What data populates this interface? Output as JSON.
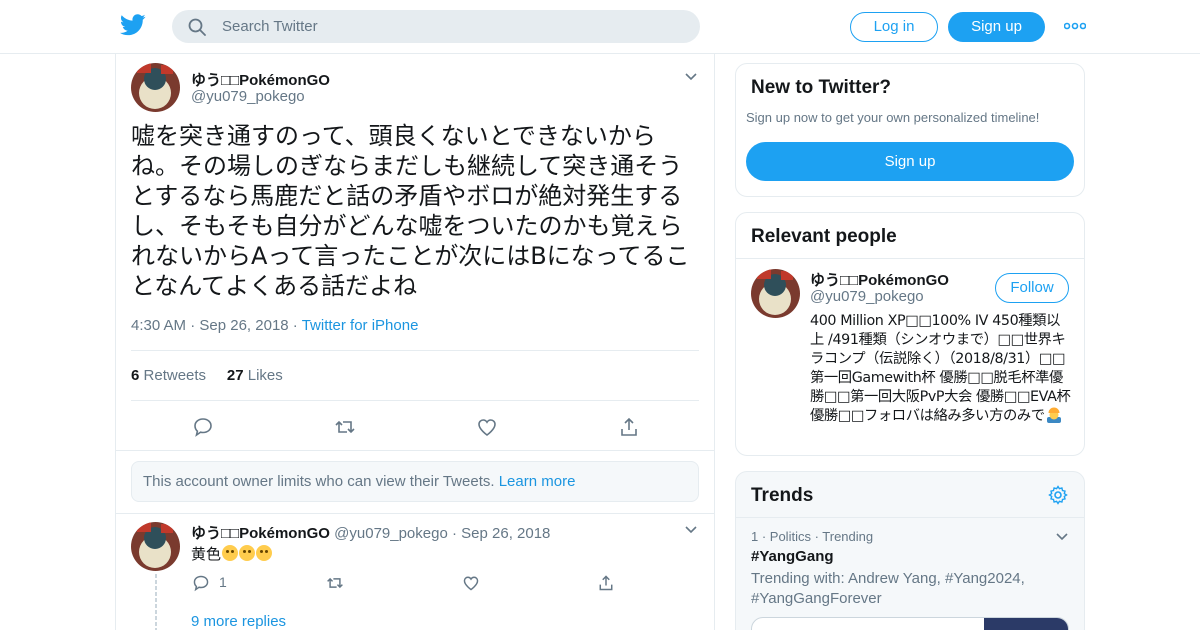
{
  "header": {
    "search_placeholder": "Search Twitter",
    "login_label": "Log in",
    "signup_label": "Sign up"
  },
  "tweet": {
    "author_name": "ゆう□□PokémonGO",
    "author_handle": "@yu079_pokego",
    "text": "嘘を突き通すのって、頭良くないとできないからね。その場しのぎならまだしも継続して突き通そうとするなら馬鹿だと話の矛盾やボロが絶対発生するし、そもそも自分がどんな嘘をついたのかも覚えられないからAって言ったことが次にはBになってることなんてよくある話だよね",
    "time": "4:30 AM",
    "date": "Sep 26, 2018",
    "source": "Twitter for iPhone",
    "retweets_count": "6",
    "retweets_label": "Retweets",
    "likes_count": "27",
    "likes_label": "Likes"
  },
  "notice": {
    "text": "This account owner limits who can view their Tweets.",
    "link": "Learn more"
  },
  "reply": {
    "author_name": "ゆう□□PokémonGO",
    "author_handle": "@yu079_pokego",
    "date": "Sep 26, 2018",
    "text": "黄色",
    "reply_count": "1",
    "more_replies": "9 more replies"
  },
  "sidebar": {
    "new_title": "New to Twitter?",
    "new_sub": "Sign up now to get your own personalized timeline!",
    "new_signup": "Sign up",
    "people_title": "Relevant people",
    "person_name": "ゆう□□PokémonGO",
    "person_handle": "@yu079_pokego",
    "follow_label": "Follow",
    "person_bio": "400 Million XP□□100% IV 450種類以上 /491種類（シンオウまで）□□世界キラコンプ（伝説除く）（2018/8/31）□□第一回Gamewith杯 優勝□□脱毛杯準優勝□□第一回大阪PvP大会 優勝□□EVA杯優勝□□フォロバは絡み多い方のみで",
    "trends_title": "Trends",
    "trend_meta": "1 · Politics · Trending",
    "trend_tag": "#YangGang",
    "trend_with": "Trending with: Andrew Yang, #Yang2024, #YangGangForever"
  },
  "colors": {
    "brand": "#1da1f2",
    "link": "#1b95e0",
    "muted": "#657786"
  },
  "icons": [
    "twitter-logo-icon",
    "search-icon",
    "more-icon",
    "chevron-down-icon",
    "reply-icon",
    "retweet-icon",
    "like-icon",
    "share-icon",
    "gear-icon"
  ]
}
